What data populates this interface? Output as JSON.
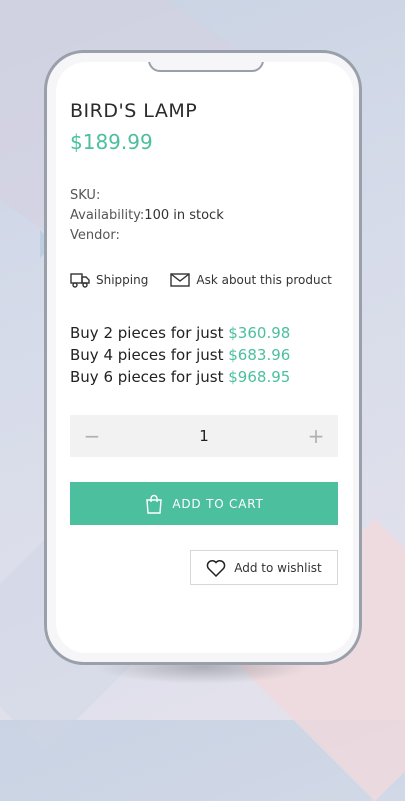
{
  "product": {
    "title": "BIRD'S LAMP",
    "price": "$189.99",
    "sku_label": "SKU:",
    "availability_label": "Availability:",
    "availability_value": "100 in stock",
    "vendor_label": "Vendor:"
  },
  "links": {
    "shipping": "Shipping",
    "ask": "Ask about this product"
  },
  "bulk_offers": [
    {
      "text": "Buy 2 pieces for just ",
      "amount": "$360.98"
    },
    {
      "text": "Buy 4 pieces for just ",
      "amount": "$683.96"
    },
    {
      "text": "Buy 6 pieces for just ",
      "amount": "$968.95"
    }
  ],
  "quantity": {
    "minus": "−",
    "value": "1",
    "plus": "+"
  },
  "actions": {
    "add_to_cart": "ADD TO CART",
    "add_to_wishlist": "Add to wishlist"
  },
  "icons": {
    "shipping": "truck-icon",
    "ask": "mail-icon",
    "cart": "shopping-bag-icon",
    "wishlist": "heart-icon"
  },
  "colors": {
    "accent": "#4bbf9e",
    "quantity_bg": "#f2f2f2"
  }
}
